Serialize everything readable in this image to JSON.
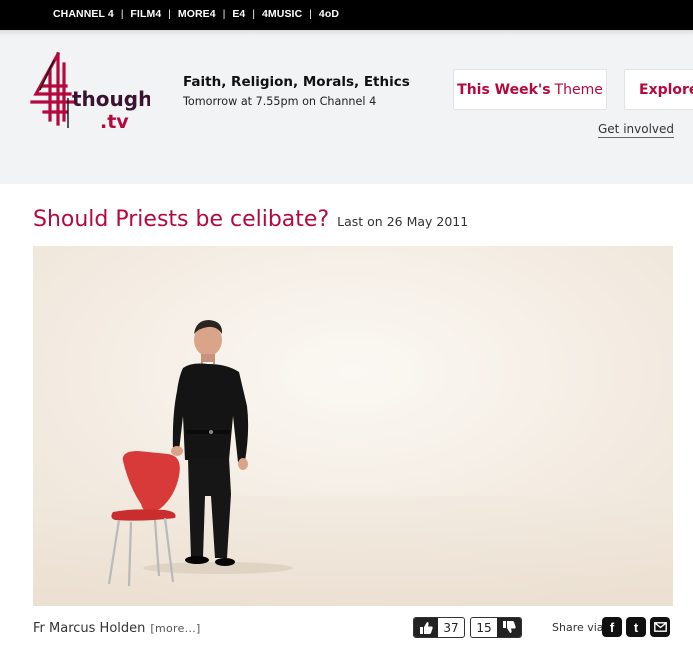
{
  "topnav": {
    "channels": [
      "CHANNEL 4",
      "FILM4",
      "MORE4",
      "E4",
      "4MUSIC",
      "4oD"
    ],
    "separator": "|"
  },
  "brand": {
    "logo_text": "thought",
    "logo_suffix": ".tv",
    "logo_numeral": "4",
    "color": "#b5093d"
  },
  "tagline": {
    "title": "Faith, Religion, Morals, Ethics",
    "subtitle": "Tomorrow at 7.55pm on Channel 4"
  },
  "header_nav": {
    "theme_strong": "This Week's",
    "theme_light": "Theme",
    "explore": "Explore",
    "get_involved": "Get involved"
  },
  "main": {
    "title": "Should Priests be celibate?",
    "last_on": "Last on 26 May 2011",
    "presenter": "Fr Marcus Holden",
    "more_link": "[more...]"
  },
  "votes": {
    "likes": "37",
    "dislikes": "15"
  },
  "share": {
    "label": "Share via",
    "services": [
      "facebook-icon",
      "twitter-icon",
      "email-icon"
    ]
  },
  "colors": {
    "accent": "#b5093d",
    "topbar": "#000000",
    "header_bg": "#f2f3f5"
  }
}
